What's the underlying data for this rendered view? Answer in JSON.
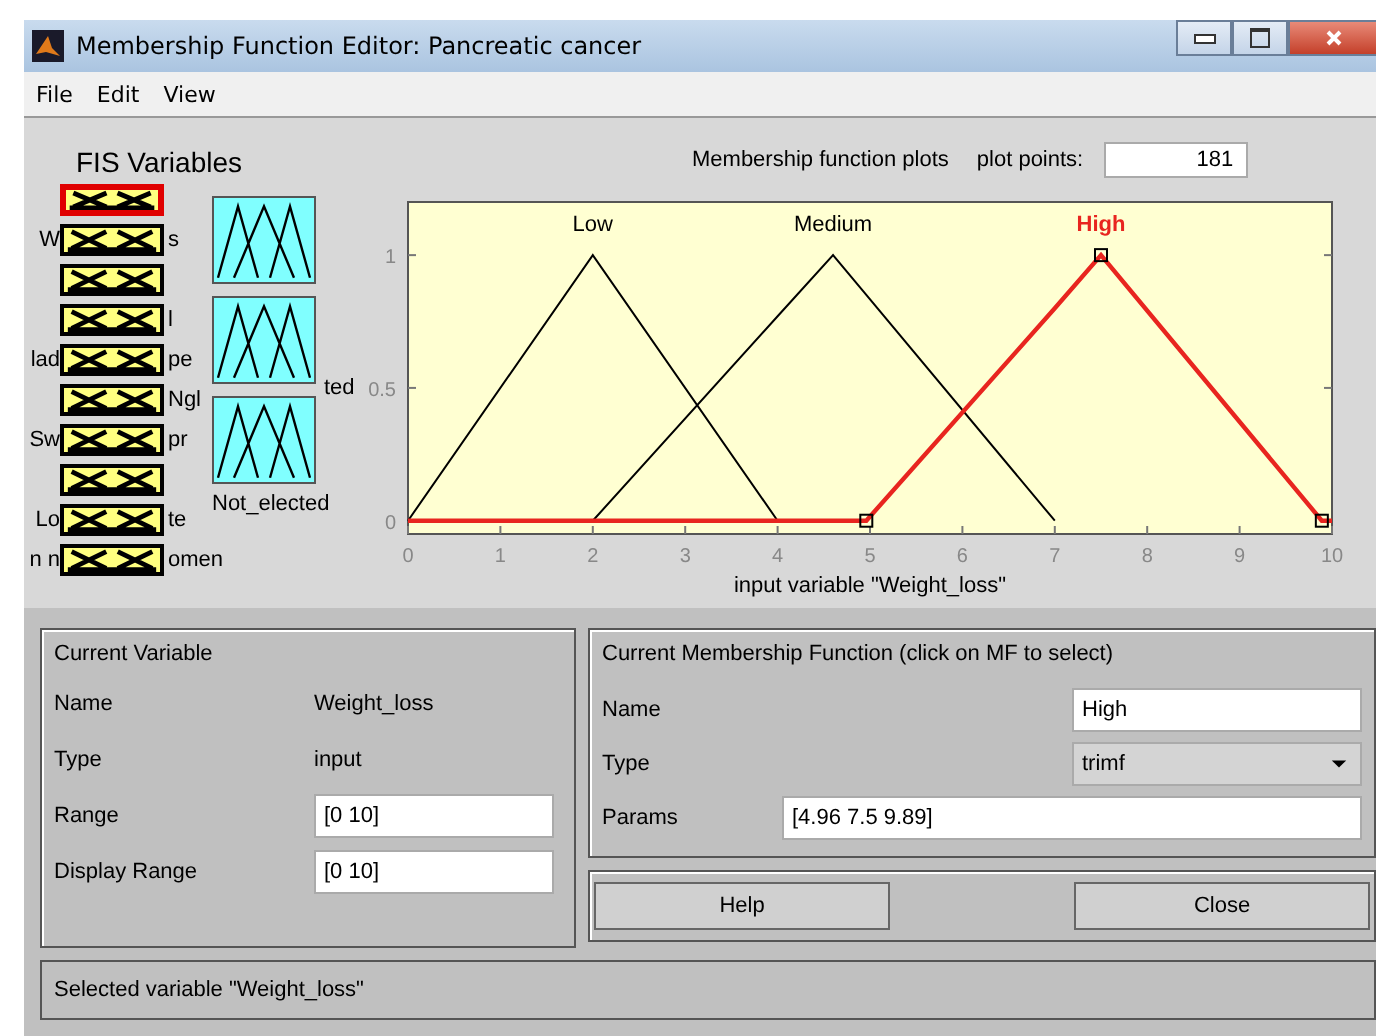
{
  "window": {
    "title": "Membership Function Editor: Pancreatic cancer"
  },
  "menu": [
    "File",
    "Edit",
    "View"
  ],
  "fis_variables": {
    "title": "FIS Variables",
    "inputs": [
      {
        "selected": true
      },
      {
        "selected": false,
        "left": "W",
        "right": "s"
      },
      {
        "selected": false
      },
      {
        "selected": false,
        "right": "l"
      },
      {
        "selected": false,
        "left": "lad",
        "right": "pe"
      },
      {
        "selected": false,
        "right": "Ngl"
      },
      {
        "selected": false,
        "left": "Sw",
        "right": "pr"
      },
      {
        "selected": false
      },
      {
        "selected": false,
        "left": "Lo",
        "right": "te"
      },
      {
        "selected": false,
        "left": "n n",
        "right": "omen"
      }
    ],
    "outputs": [
      {
        "selected": false
      },
      {
        "selected": false,
        "label": "ted"
      },
      {
        "selected": false,
        "label": "Not_elected"
      }
    ]
  },
  "plot": {
    "title": "Membership function plots",
    "plot_points_label": "plot points:",
    "plot_points": "181",
    "mf_states": [
      {
        "selected": false
      },
      {
        "selected": false
      },
      {
        "selected": true
      }
    ],
    "chart_data": {
      "type": "line",
      "xlabel": "input variable \"Weight_loss\"",
      "x": [
        0,
        2,
        4,
        4.6,
        4.96,
        7,
        7.5,
        9.89,
        10
      ],
      "xlim": [
        0,
        10
      ],
      "ylim": [
        -0.05,
        1.2
      ],
      "xticks": [
        0,
        1,
        2,
        3,
        4,
        5,
        6,
        7,
        8,
        9,
        10
      ],
      "yticks": [
        0,
        0.5,
        1
      ],
      "series": [
        {
          "name": "Low",
          "color": "#000000",
          "values": [
            0,
            1,
            0,
            null,
            null,
            null,
            null,
            null,
            null
          ]
        },
        {
          "name": "Medium",
          "color": "#000000",
          "values": [
            null,
            0,
            0.77,
            1,
            0.85,
            0,
            null,
            null,
            null
          ]
        },
        {
          "name": "High",
          "color": "#e8251f",
          "values": [
            0,
            0,
            0,
            0,
            0,
            0.8,
            1,
            0,
            0
          ]
        }
      ]
    }
  },
  "current_variable": {
    "title": "Current Variable",
    "name_label": "Name",
    "name": "Weight_loss",
    "type_label": "Type",
    "type": "input",
    "range_label": "Range",
    "range": "[0 10]",
    "display_range_label": "Display Range",
    "display_range": "[0 10]"
  },
  "current_mf": {
    "title": "Current Membership Function (click on MF to select)",
    "name_label": "Name",
    "name": "High",
    "type_label": "Type",
    "type": "trimf",
    "params_label": "Params",
    "params": "[4.96 7.5 9.89]"
  },
  "buttons": [
    "Help",
    "Close"
  ],
  "status_bar": "Selected variable \"Weight_loss\""
}
